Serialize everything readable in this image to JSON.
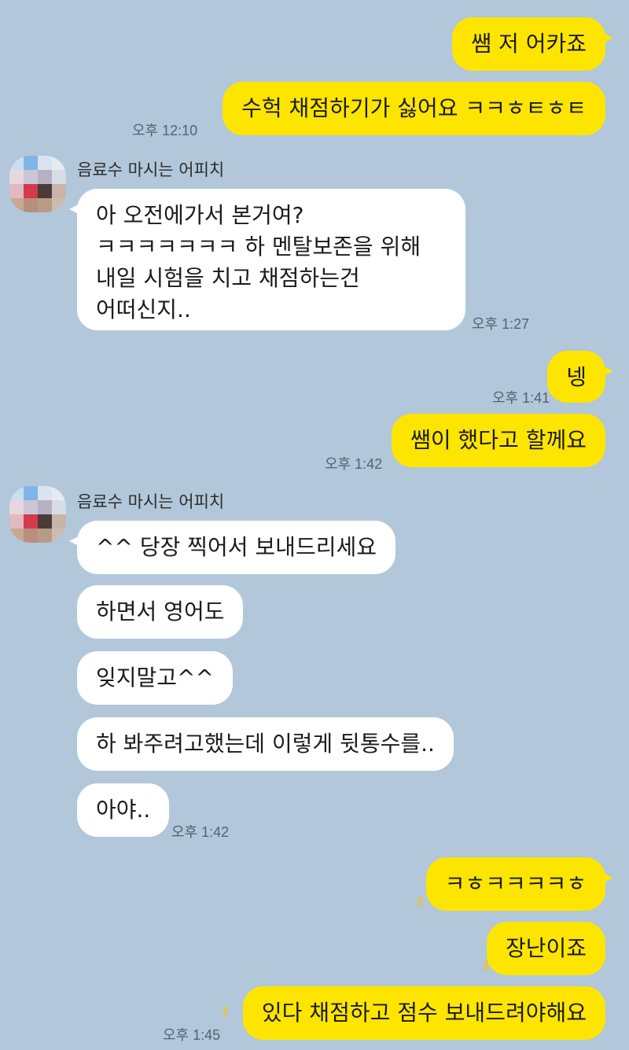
{
  "chat": {
    "contact_name": "음료수 마시는 어피치",
    "messages": [
      {
        "id": "m1",
        "from": "me",
        "text": "쌤 저 어카죠"
      },
      {
        "id": "m2",
        "from": "me",
        "text": "수헉 채점하기가 싫어요 ㅋㅋㅎㅌㅎㅌ",
        "time": "오후 12:10"
      },
      {
        "id": "m3",
        "from": "them",
        "text": "아 오전에가서 본거여?\nㅋㅋㅋㅋㅋㅋㅋ 하 멘탈보존을 위해\n내일 시험을 치고 채점하는건\n어떠신지..",
        "time": "오후 1:27"
      },
      {
        "id": "m4",
        "from": "me",
        "text": "넹",
        "time": "오후 1:41"
      },
      {
        "id": "m5",
        "from": "me",
        "text": "쌤이 했다고 할께요",
        "time": "오후 1:42"
      },
      {
        "id": "m6",
        "from": "them",
        "text": "^^ 당장 찍어서 보내드리세요"
      },
      {
        "id": "m7",
        "from": "them",
        "text": "하면서 영어도"
      },
      {
        "id": "m8",
        "from": "them",
        "text": "잊지말고^^"
      },
      {
        "id": "m9",
        "from": "them",
        "text": "하 봐주려고했는데 이렇게 뒷통수를.."
      },
      {
        "id": "m10",
        "from": "them",
        "text": "아야..",
        "time": "오후 1:42"
      },
      {
        "id": "m11",
        "from": "me",
        "text": "ㅋㅎㅋㅋㅋㅋㅎ",
        "unread": "1"
      },
      {
        "id": "m12",
        "from": "me",
        "text": "장난이죠",
        "unread": "1"
      },
      {
        "id": "m13",
        "from": "me",
        "text": "있다 채점하고 점수 보내드려야해요",
        "unread": "1",
        "time": "오후 1:45"
      }
    ]
  },
  "colors": {
    "background": "#b2c7da",
    "my_bubble": "#fee500",
    "their_bubble": "#ffffff",
    "unread": "#f0c419"
  }
}
